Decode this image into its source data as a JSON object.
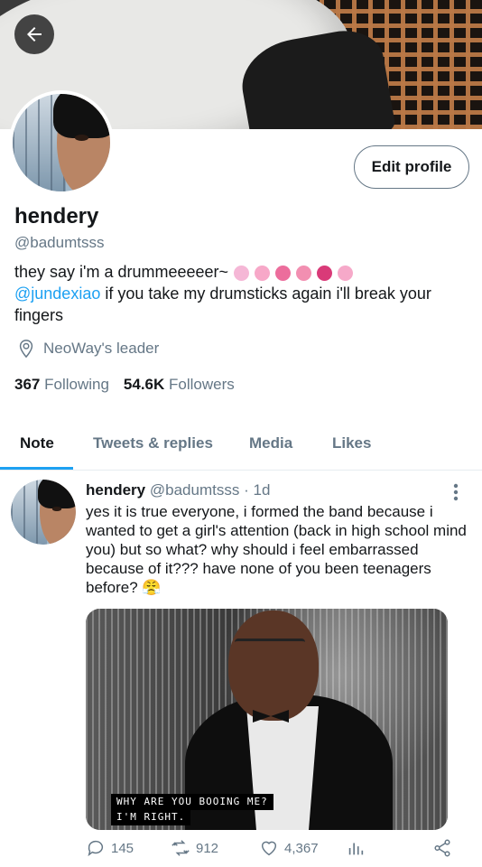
{
  "profile": {
    "name": "hendery",
    "handle": "@badumtsss",
    "edit_label": "Edit profile",
    "bio_line1": "they say i'm a drummeeeeer~",
    "bio_mention": "@jundexiao",
    "bio_rest": " if you take my drumsticks again i'll break your fingers",
    "location": "NeoWay's leader",
    "following_count": "367",
    "following_label": "Following",
    "followers_count": "54.6K",
    "followers_label": "Followers",
    "bio_emoji_colors": [
      "#f5b7d6",
      "#f7a8c8",
      "#ec6d9c",
      "#f28fb1",
      "#d93a78",
      "#f6a9c9"
    ]
  },
  "tabs": [
    {
      "label": "Note",
      "active": true
    },
    {
      "label": "Tweets & replies",
      "active": false
    },
    {
      "label": "Media",
      "active": false
    },
    {
      "label": "Likes",
      "active": false
    }
  ],
  "tweet": {
    "name": "hendery",
    "handle": "@badumtsss",
    "sep": "·",
    "time": "1d",
    "text": "yes it is true everyone, i formed the band because i wanted to get a girl's attention (back in high school mind you) but so what? why should i feel embarrassed because of it??? have none of you been teenagers before? 😤",
    "media_caption_line1": "WHY ARE YOU BOOING ME?",
    "media_caption_line2": "I'M RIGHT.",
    "replies": "145",
    "retweets": "912",
    "likes": "4,367"
  },
  "colors": {
    "accent": "#1da1f2",
    "secondary_text": "#657786",
    "primary_text": "#14171a"
  }
}
